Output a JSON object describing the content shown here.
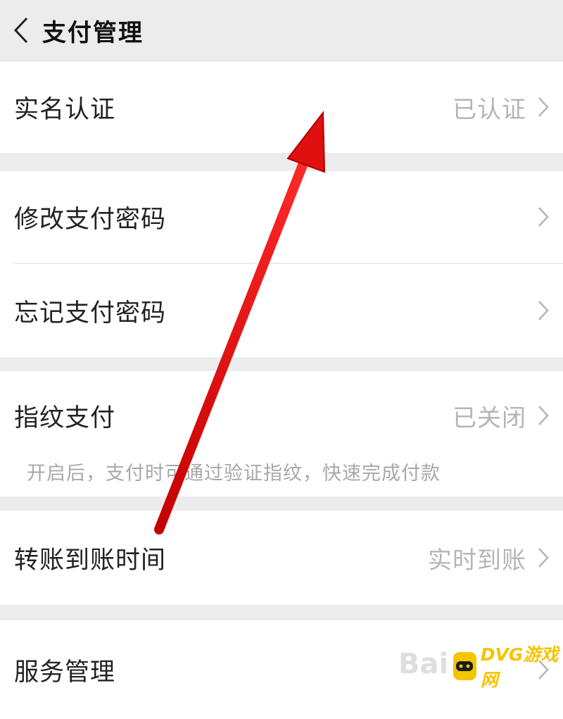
{
  "header": {
    "title": "支付管理",
    "back_icon": "chevron-left-icon"
  },
  "items": {
    "real_name": {
      "label": "实名认证",
      "value": "已认证"
    },
    "modify_password": {
      "label": "修改支付密码"
    },
    "forget_password": {
      "label": "忘记支付密码"
    },
    "fingerprint": {
      "label": "指纹支付",
      "value": "已关闭",
      "description": "开启后，支付时可通过验证指纹，快速完成付款"
    },
    "transfer_time": {
      "label": "转账到账时间",
      "value": "实时到账"
    },
    "service_manage": {
      "label": "服务管理"
    }
  },
  "watermark": {
    "baidu": "Bai",
    "dvg": "DVG游戏网"
  },
  "colors": {
    "background": "#ececec",
    "row": "#ffffff",
    "text": "#222222",
    "muted": "#b5b5b5",
    "annotation_arrow": "#e01010",
    "dvg_accent": "#f5c400"
  }
}
